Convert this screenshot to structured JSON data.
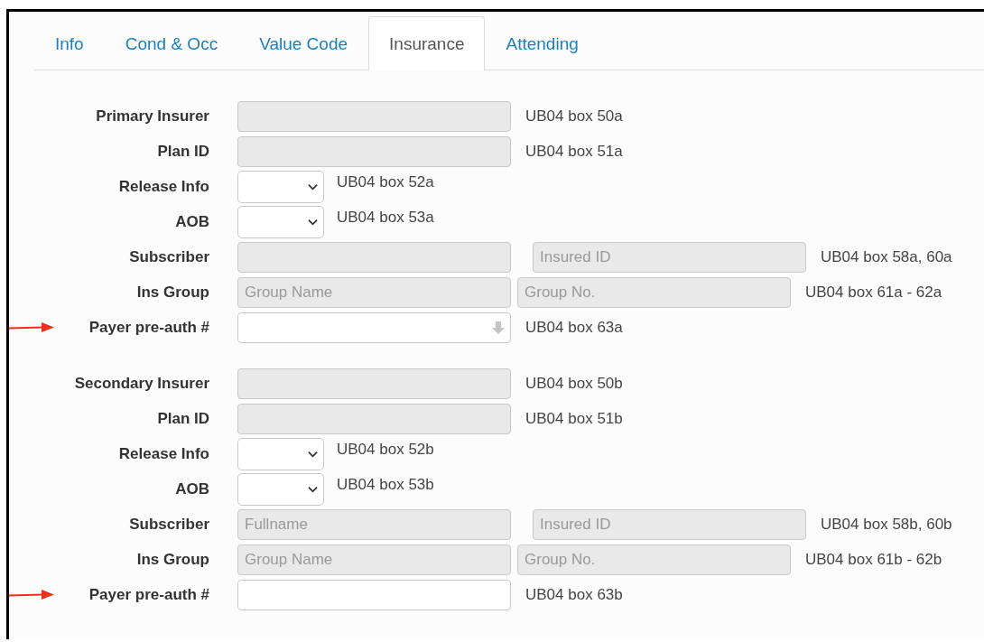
{
  "tabs": [
    {
      "label": "Info",
      "selected": false
    },
    {
      "label": "Cond & Occ",
      "selected": false
    },
    {
      "label": "Value Code",
      "selected": false
    },
    {
      "label": "Insurance",
      "selected": true
    },
    {
      "label": "Attending",
      "selected": false
    }
  ],
  "sections": [
    {
      "rows": [
        {
          "kind": "input",
          "label": "Primary Insurer",
          "arrow": false,
          "fields": [
            {
              "disabled": true
            }
          ],
          "note": "UB04 box 50a"
        },
        {
          "kind": "input",
          "label": "Plan ID",
          "arrow": false,
          "fields": [
            {
              "disabled": true
            }
          ],
          "note": "UB04 box 51a"
        },
        {
          "kind": "select",
          "label": "Release Info",
          "arrow": false,
          "fields": [
            {
              "disabled": false
            }
          ],
          "note": "UB04 box 52a"
        },
        {
          "kind": "select",
          "label": "AOB",
          "arrow": false,
          "fields": [
            {
              "disabled": false
            }
          ],
          "note": "UB04 box 53a"
        },
        {
          "kind": "subscriber",
          "label": "Subscriber",
          "arrow": false,
          "fields": [
            {
              "disabled": true
            },
            {
              "disabled": true,
              "placeholder": "Insured ID"
            }
          ],
          "note": "UB04 box 58a, 60a"
        },
        {
          "kind": "group",
          "label": "Ins Group",
          "arrow": false,
          "fields": [
            {
              "disabled": true,
              "placeholder": "Group Name"
            },
            {
              "disabled": true,
              "placeholder": "Group No."
            }
          ],
          "note": "UB04 box 61a - 62a"
        },
        {
          "kind": "download",
          "label": "Payer pre-auth #",
          "arrow": true,
          "fields": [
            {
              "disabled": false
            }
          ],
          "note": "UB04 box 63a"
        }
      ]
    },
    {
      "rows": [
        {
          "kind": "input",
          "label": "Secondary Insurer",
          "arrow": false,
          "fields": [
            {
              "disabled": true
            }
          ],
          "note": "UB04 box 50b"
        },
        {
          "kind": "input",
          "label": "Plan ID",
          "arrow": false,
          "fields": [
            {
              "disabled": true
            }
          ],
          "note": "UB04 box 51b"
        },
        {
          "kind": "select",
          "label": "Release Info",
          "arrow": false,
          "fields": [
            {
              "disabled": false
            }
          ],
          "note": "UB04 box 52b"
        },
        {
          "kind": "select",
          "label": "AOB",
          "arrow": false,
          "fields": [
            {
              "disabled": false
            }
          ],
          "note": "UB04 box 53b"
        },
        {
          "kind": "subscriber",
          "label": "Subscriber",
          "arrow": false,
          "fields": [
            {
              "disabled": true,
              "placeholder": "Fullname"
            },
            {
              "disabled": true,
              "placeholder": "Insured ID"
            }
          ],
          "note": "UB04 box 58b, 60b"
        },
        {
          "kind": "group",
          "label": "Ins Group",
          "arrow": false,
          "fields": [
            {
              "disabled": true,
              "placeholder": "Group Name"
            },
            {
              "disabled": true,
              "placeholder": "Group No."
            }
          ],
          "note": "UB04 box 61b - 62b"
        },
        {
          "kind": "input",
          "label": "Payer pre-auth #",
          "arrow": true,
          "fields": [
            {
              "disabled": false
            }
          ],
          "note": "UB04 box 63b"
        }
      ]
    }
  ]
}
